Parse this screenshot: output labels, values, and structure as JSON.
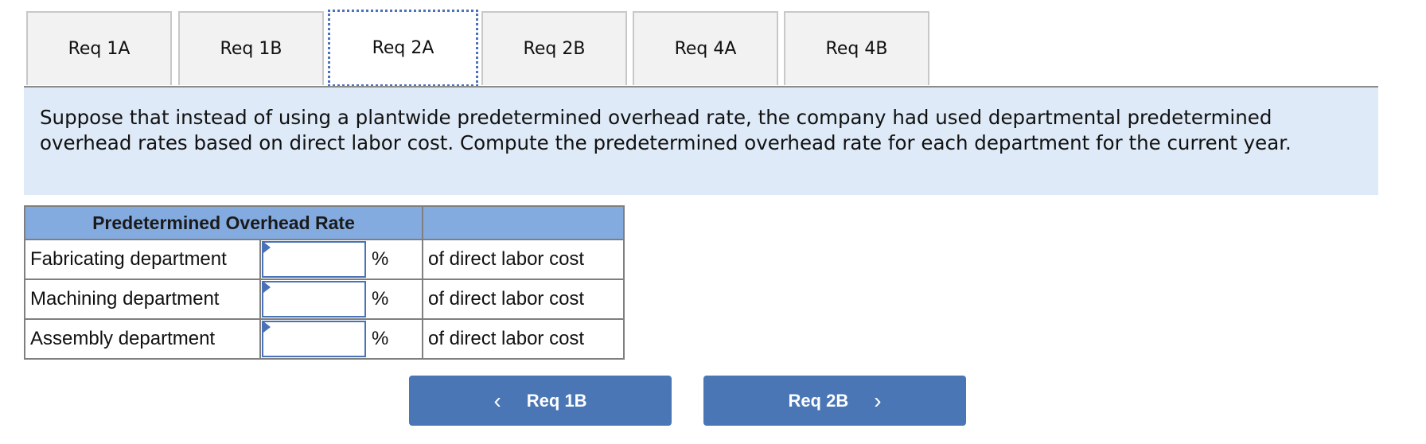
{
  "tabs": [
    {
      "label": "Req 1A",
      "active": false
    },
    {
      "label": "Req 1B",
      "active": false
    },
    {
      "label": "Req 2A",
      "active": true
    },
    {
      "label": "Req 2B",
      "active": false
    },
    {
      "label": "Req 4A",
      "active": false
    },
    {
      "label": "Req 4B",
      "active": false
    }
  ],
  "instructions": "Suppose that instead of using a plantwide predetermined overhead rate, the company had used departmental predetermined overhead rates based on direct labor cost. Compute the predetermined overhead rate for each department for the current year.",
  "table": {
    "header": "Predetermined Overhead Rate",
    "header_right": "",
    "rows": [
      {
        "label": "Fabricating department",
        "value": "",
        "unit": "%",
        "description": "of direct labor cost"
      },
      {
        "label": "Machining department",
        "value": "",
        "unit": "%",
        "description": "of direct labor cost"
      },
      {
        "label": "Assembly department",
        "value": "",
        "unit": "%",
        "description": "of direct labor cost"
      }
    ]
  },
  "navigation": {
    "prev_label": "Req 1B",
    "next_label": "Req 2B",
    "prev_icon": "chevron-left-icon",
    "next_icon": "chevron-right-icon"
  },
  "colors": {
    "accent": "#4a76b5",
    "panel_bg": "#deeaf7",
    "table_header_bg": "#84abe0",
    "tab_bg": "#f2f2f2"
  }
}
